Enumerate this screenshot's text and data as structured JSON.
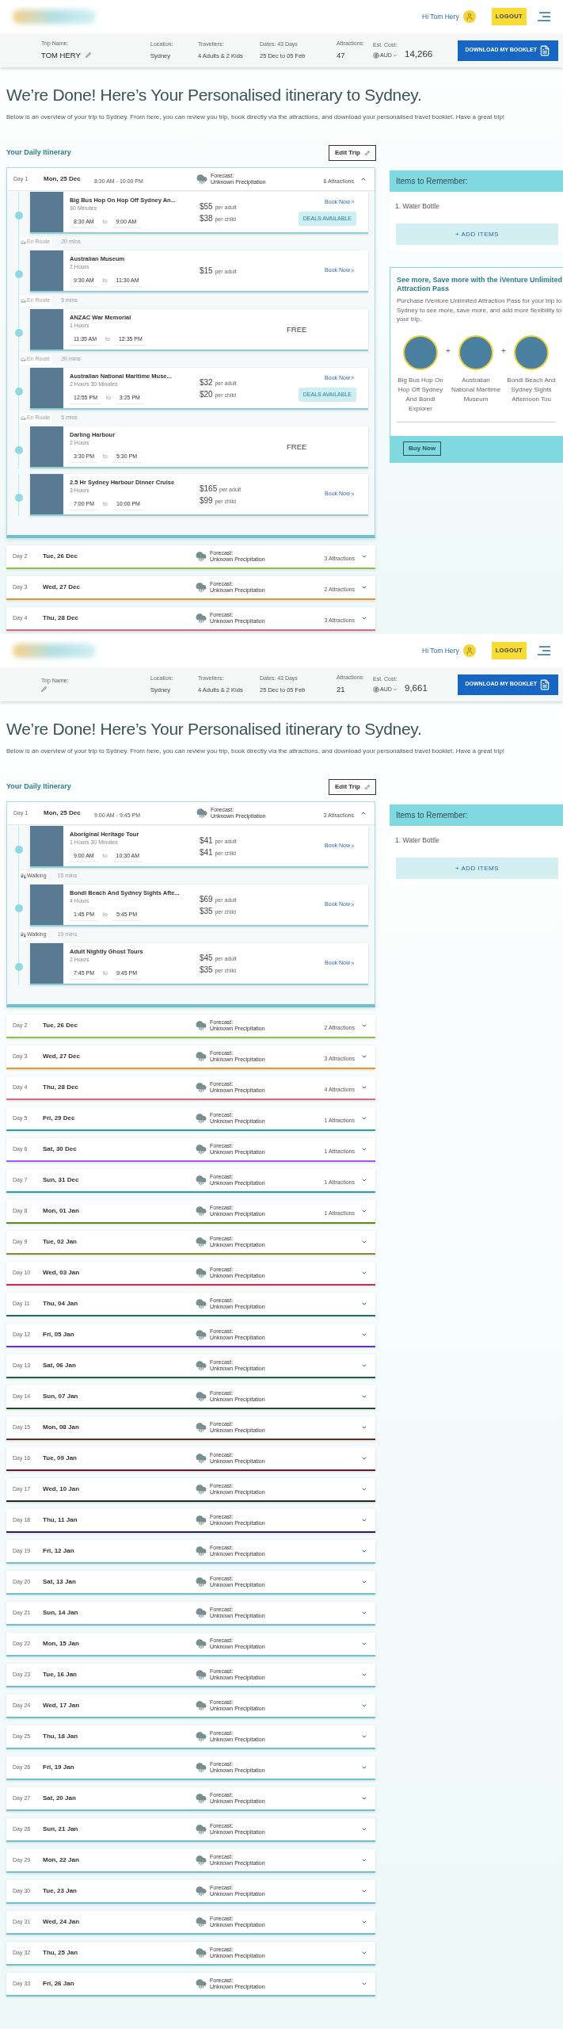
{
  "screens": [
    {
      "header": {
        "greeting": "Hi Tom Hery",
        "logout": "LOGOUT"
      },
      "trip_bar": {
        "trip_name_label": "Trip Name:",
        "trip_name": "TOM HERY",
        "location_label": "Location:",
        "location": "Sydney",
        "travellers_label": "Travellers:",
        "travellers": "4 Adults & 2 Kids",
        "dates_label": "Dates: 43 Days",
        "dates": "25 Dec to 05 Feb",
        "attractions_label": "Attractions:",
        "attractions": "47",
        "cost_label": "Est. Cost:",
        "currency": "AUD",
        "cost": "14,266",
        "download": "DOWNLOAD MY BOOKLET"
      },
      "heading": "We’re Done! Here’s Your Personalised itinerary to Sydney.",
      "intro": "Below is an overview of your trip to Sydney. From here, you can review you trip, book directly via the attractions, and download your personalised travel booklet. Have a great trip!",
      "itinerary_title": "Your Daily Itinerary",
      "edit_button": "Edit Trip",
      "days": [
        {
          "day": "Day 1",
          "date": "Mon, 25 Dec",
          "time": "8:30 AM - 10:00 PM",
          "forecast_label": "Forecast:",
          "forecast": "Unknown Precipitation",
          "count": "6 Attractions",
          "expanded": true,
          "color": "#6cc3cf",
          "attractions": [
            {
              "name": "Big Bus Hop On Hop Off Sydney An...",
              "duration": "30 Minutes",
              "start": "8:30 AM",
              "to": "to",
              "end": "9:00 AM",
              "prices": [
                {
                  "amount": "$55",
                  "unit": "per adult"
                },
                {
                  "amount": "$38",
                  "unit": "per child"
                }
              ],
              "book": "Book Now",
              "deals": "DEALS AVAILABLE",
              "transit": {
                "kind": "drive",
                "mode": "En Route",
                "time": "20 mins"
              }
            },
            {
              "name": "Australian Museum",
              "duration": "2 Hours",
              "start": "9:30 AM",
              "to": "to",
              "end": "11:30 AM",
              "prices": [
                {
                  "amount": "$15",
                  "unit": "per adult"
                }
              ],
              "book": "Book Now",
              "transit": {
                "kind": "drive",
                "mode": "En Route",
                "time": "5 mins"
              }
            },
            {
              "name": "ANZAC War Memorial",
              "duration": "1 Hours",
              "start": "11:35 AM",
              "to": "to",
              "end": "12:35 PM",
              "free": "FREE",
              "transit": {
                "kind": "drive",
                "mode": "En Route",
                "time": "20 mins"
              }
            },
            {
              "name": "Australian National Maritime Muse...",
              "duration": "2 Hours 30 Minutes",
              "start": "12:55 PM",
              "to": "to",
              "end": "3:25 PM",
              "prices": [
                {
                  "amount": "$32",
                  "unit": "per adult"
                },
                {
                  "amount": "$20",
                  "unit": "per child"
                }
              ],
              "book": "Book Now",
              "deals": "DEALS AVAILABLE",
              "transit": {
                "kind": "drive",
                "mode": "En Route",
                "time": "5 mins"
              }
            },
            {
              "name": "Darling Harbour",
              "duration": "2 Hours",
              "start": "3:30 PM",
              "to": "to",
              "end": "5:30 PM",
              "free": "FREE"
            },
            {
              "name": "2.5 Hr Sydney Harbour Dinner Cruise",
              "duration": "3 Hours",
              "start": "7:00 PM",
              "to": "to",
              "end": "10:00 PM",
              "prices": [
                {
                  "amount": "$165",
                  "unit": "per adult"
                },
                {
                  "amount": "$99",
                  "unit": "per child"
                }
              ],
              "book": "Book Now"
            }
          ]
        },
        {
          "day": "Day 2",
          "date": "Tue, 26 Dec",
          "forecast_label": "Forecast:",
          "forecast": "Unknown Precipitation",
          "count": "3 Attractions",
          "expanded": false,
          "color": "#8bc34a"
        },
        {
          "day": "Day 3",
          "date": "Wed, 27 Dec",
          "forecast_label": "Forecast:",
          "forecast": "Unknown Precipitation",
          "count": "2 Attractions",
          "expanded": false,
          "color": "#f0932b"
        },
        {
          "day": "Day 4",
          "date": "Thu, 28 Dec",
          "forecast_label": "Forecast:",
          "forecast": "Unknown Precipitation",
          "count": "3 Attractions",
          "expanded": false,
          "color": "#d96b80"
        }
      ],
      "sidebar": {
        "items_title": "Items to Remember:",
        "items": [
          "1. Water Bottle"
        ],
        "add_button": "+ ADD ITEMS",
        "promo": {
          "title": "See more, Save more with the iVenture Unlimited Attraction Pass",
          "text": "Purchase iVenture Unlimited Attraction Pass for your trip to Sydney to see more, save more, and add more flexibility to your trip.",
          "plus": "+",
          "attractions": [
            "Big Bus Hop On Hop Off Sydney And Bondi Explorer",
            "Australian National Maritime Museum",
            "Bondi Beach And Sydney Sights Afternoon Tou"
          ],
          "buy": "Buy Now"
        }
      }
    },
    {
      "header": {
        "greeting": "Hi Tom Hery",
        "logout": "LOGOUT"
      },
      "trip_bar": {
        "trip_name_label": "Trip Name:",
        "location_label": "Location:",
        "location": "Sydney",
        "travellers_label": "Travellers:",
        "travellers": "4 Adults & 2 Kids",
        "dates_label": "Dates: 43 Days",
        "dates": "25 Dec to 05 Feb",
        "attractions_label": "Attractions:",
        "attractions": "21",
        "cost_label": "Est. Cost:",
        "currency": "AUD",
        "cost": "9,661",
        "download": "DOWNLOAD MY BOOKLET"
      },
      "heading": "We’re Done! Here’s Your Personalised itinerary to Sydney.",
      "intro": "Below is an overview of your trip to Sydney. From here, you can review you trip, book directly via the attractions, and download your personalised travel booklet. Have a great trip!",
      "itinerary_title": "Your Daily Itinerary",
      "edit_button": "Edit Trip",
      "days": [
        {
          "day": "Day 1",
          "date": "Mon, 25 Dec",
          "time": "9:00 AM - 9:45 PM",
          "forecast_label": "Forecast:",
          "forecast": "Unknown Precipitation",
          "count": "3 Attractions",
          "expanded": true,
          "color": "#6cc3cf",
          "attractions": [
            {
              "name": "Aboriginal Heritage Tour",
              "duration": "1 Hours 30 Minutes",
              "start": "9:00 AM",
              "to": "to",
              "end": "10:30 AM",
              "prices": [
                {
                  "amount": "$41",
                  "unit": "per adult"
                },
                {
                  "amount": "$41",
                  "unit": "per child"
                }
              ],
              "book": "Book Now",
              "transit": {
                "kind": "walk",
                "mode": "Walking",
                "time": "15 mins"
              }
            },
            {
              "name": "Bondi Beach And Sydney Sights Afte...",
              "duration": "4 Hours",
              "start": "1:45 PM",
              "to": "to",
              "end": "5:45 PM",
              "prices": [
                {
                  "amount": "$69",
                  "unit": "per adult"
                },
                {
                  "amount": "$35",
                  "unit": "per child"
                }
              ],
              "book": "Book Now",
              "transit": {
                "kind": "walk",
                "mode": "Walking",
                "time": "10 mins"
              }
            },
            {
              "name": "Adult Nightly Ghost Tours",
              "duration": "2 Hours",
              "start": "7:45 PM",
              "to": "to",
              "end": "9:45 PM",
              "prices": [
                {
                  "amount": "$45",
                  "unit": "per adult"
                },
                {
                  "amount": "$35",
                  "unit": "per child"
                }
              ],
              "book": "Book Now"
            }
          ]
        },
        {
          "day": "Day 2",
          "date": "Tue, 26 Dec",
          "forecast_label": "Forecast:",
          "forecast": "Unknown Precipitation",
          "count": "2 Attractions",
          "expanded": false,
          "color": "#8bc34a"
        },
        {
          "day": "Day 3",
          "date": "Wed, 27 Dec",
          "forecast_label": "Forecast:",
          "forecast": "Unknown Precipitation",
          "count": "3 Attractions",
          "expanded": false,
          "color": "#f0932b"
        },
        {
          "day": "Day 4",
          "date": "Thu, 28 Dec",
          "forecast_label": "Forecast:",
          "forecast": "Unknown Precipitation",
          "count": "4 Attractions",
          "expanded": false,
          "color": "#d96b80"
        },
        {
          "day": "Day 5",
          "date": "Fri, 29 Dec",
          "forecast_label": "Forecast:",
          "forecast": "Unknown Precipitation",
          "count": "1 Attractions",
          "expanded": false,
          "color": "#26a69a"
        },
        {
          "day": "Day 6",
          "date": "Sat, 30 Dec",
          "forecast_label": "Forecast:",
          "forecast": "Unknown Precipitation",
          "count": "1 Attractions",
          "expanded": false,
          "color": "#a855f7"
        },
        {
          "day": "Day 7",
          "date": "Sun, 31 Dec",
          "forecast_label": "Forecast:",
          "forecast": "Unknown Precipitation",
          "count": "1 Attractions",
          "expanded": false,
          "color": "#2a9db5"
        },
        {
          "day": "Day 8",
          "date": "Mon, 01 Jan",
          "forecast_label": "Forecast:",
          "forecast": "Unknown Precipitation",
          "count": "1 Attractions",
          "expanded": false,
          "color": "#5e8a1e"
        },
        {
          "day": "Day 9",
          "date": "Tue, 02 Jan",
          "forecast_label": "Forecast:",
          "forecast": "Unknown Precipitation",
          "expanded": false,
          "color": "#8a8a2a"
        },
        {
          "day": "Day 10",
          "date": "Wed, 03 Jan",
          "forecast_label": "Forecast:",
          "forecast": "Unknown Precipitation",
          "expanded": false,
          "color": "#c0304a"
        },
        {
          "day": "Day 11",
          "date": "Thu, 04 Jan",
          "forecast_label": "Forecast:",
          "forecast": "Unknown Precipitation",
          "expanded": false,
          "color": "#1f6f5f"
        },
        {
          "day": "Day 12",
          "date": "Fri, 05 Jan",
          "forecast_label": "Forecast:",
          "forecast": "Unknown Precipitation",
          "expanded": false,
          "color": "#6a2dc0"
        },
        {
          "day": "Day 13",
          "date": "Sat, 06 Jan",
          "forecast_label": "Forecast:",
          "forecast": "Unknown Precipitation",
          "expanded": false,
          "color": "#1f5f4a"
        },
        {
          "day": "Day 14",
          "date": "Sun, 07 Jan",
          "forecast_label": "Forecast:",
          "forecast": "Unknown Precipitation",
          "expanded": false,
          "color": "#1e4d2b"
        },
        {
          "day": "Day 15",
          "date": "Mon, 08 Jan",
          "forecast_label": "Forecast:",
          "forecast": "Unknown Precipitation",
          "expanded": false,
          "color": "#6b2a1a"
        },
        {
          "day": "Day 16",
          "date": "Tue, 09 Jan",
          "forecast_label": "Forecast:",
          "forecast": "Unknown Precipitation",
          "expanded": false,
          "color": "#6b1a2a"
        },
        {
          "day": "Day 17",
          "date": "Wed, 10 Jan",
          "forecast_label": "Forecast:",
          "forecast": "Unknown Precipitation",
          "expanded": false,
          "color": "#1a2a2a"
        },
        {
          "day": "Day 18",
          "date": "Thu, 11 Jan",
          "forecast_label": "Forecast:",
          "forecast": "Unknown Precipitation",
          "expanded": false,
          "color": "#2a2050"
        },
        {
          "day": "Day 19",
          "date": "Fri, 12 Jan",
          "forecast_label": "Forecast:",
          "forecast": "Unknown Precipitation",
          "expanded": false,
          "color": "#6cc3cf"
        },
        {
          "day": "Day 20",
          "date": "Sat, 13 Jan",
          "forecast_label": "Forecast:",
          "forecast": "Unknown Precipitation",
          "expanded": false,
          "color": "#6cc3cf"
        },
        {
          "day": "Day 21",
          "date": "Sun, 14 Jan",
          "forecast_label": "Forecast:",
          "forecast": "Unknown Precipitation",
          "expanded": false,
          "color": "#6cc3cf"
        },
        {
          "day": "Day 22",
          "date": "Mon, 15 Jan",
          "forecast_label": "Forecast:",
          "forecast": "Unknown Precipitation",
          "expanded": false,
          "color": "#6cc3cf"
        },
        {
          "day": "Day 23",
          "date": "Tue, 16 Jan",
          "forecast_label": "Forecast:",
          "forecast": "Unknown Precipitation",
          "expanded": false,
          "color": "#6cc3cf"
        },
        {
          "day": "Day 24",
          "date": "Wed, 17 Jan",
          "forecast_label": "Forecast:",
          "forecast": "Unknown Precipitation",
          "expanded": false,
          "color": "#6cc3cf"
        },
        {
          "day": "Day 25",
          "date": "Thu, 18 Jan",
          "forecast_label": "Forecast:",
          "forecast": "Unknown Precipitation",
          "expanded": false,
          "color": "#6cc3cf"
        },
        {
          "day": "Day 26",
          "date": "Fri, 19 Jan",
          "forecast_label": "Forecast:",
          "forecast": "Unknown Precipitation",
          "expanded": false,
          "color": "#6cc3cf"
        },
        {
          "day": "Day 27",
          "date": "Sat, 20 Jan",
          "forecast_label": "Forecast:",
          "forecast": "Unknown Precipitation",
          "expanded": false,
          "color": "#6cc3cf"
        },
        {
          "day": "Day 28",
          "date": "Sun, 21 Jan",
          "forecast_label": "Forecast:",
          "forecast": "Unknown Precipitation",
          "expanded": false,
          "color": "#6cc3cf"
        },
        {
          "day": "Day 29",
          "date": "Mon, 22 Jan",
          "forecast_label": "Forecast:",
          "forecast": "Unknown Precipitation",
          "expanded": false,
          "color": "#6cc3cf"
        },
        {
          "day": "Day 30",
          "date": "Tue, 23 Jan",
          "forecast_label": "Forecast:",
          "forecast": "Unknown Precipitation",
          "expanded": false,
          "color": "#6cc3cf"
        },
        {
          "day": "Day 31",
          "date": "Wed, 24 Jan",
          "forecast_label": "Forecast:",
          "forecast": "Unknown Precipitation",
          "expanded": false,
          "color": "#6cc3cf"
        },
        {
          "day": "Day 32",
          "date": "Thu, 25 Jan",
          "forecast_label": "Forecast:",
          "forecast": "Unknown Precipitation",
          "expanded": false,
          "color": "#6cc3cf"
        },
        {
          "day": "Day 33",
          "date": "Fri, 26 Jan",
          "forecast_label": "Forecast:",
          "forecast": "Unknown Precipitation",
          "expanded": false,
          "color": "#6cc3cf"
        }
      ],
      "sidebar": {
        "items_title": "Items to Remember:",
        "items": [
          "1. Water Bottle"
        ],
        "add_button": "+ ADD ITEMS"
      }
    }
  ]
}
